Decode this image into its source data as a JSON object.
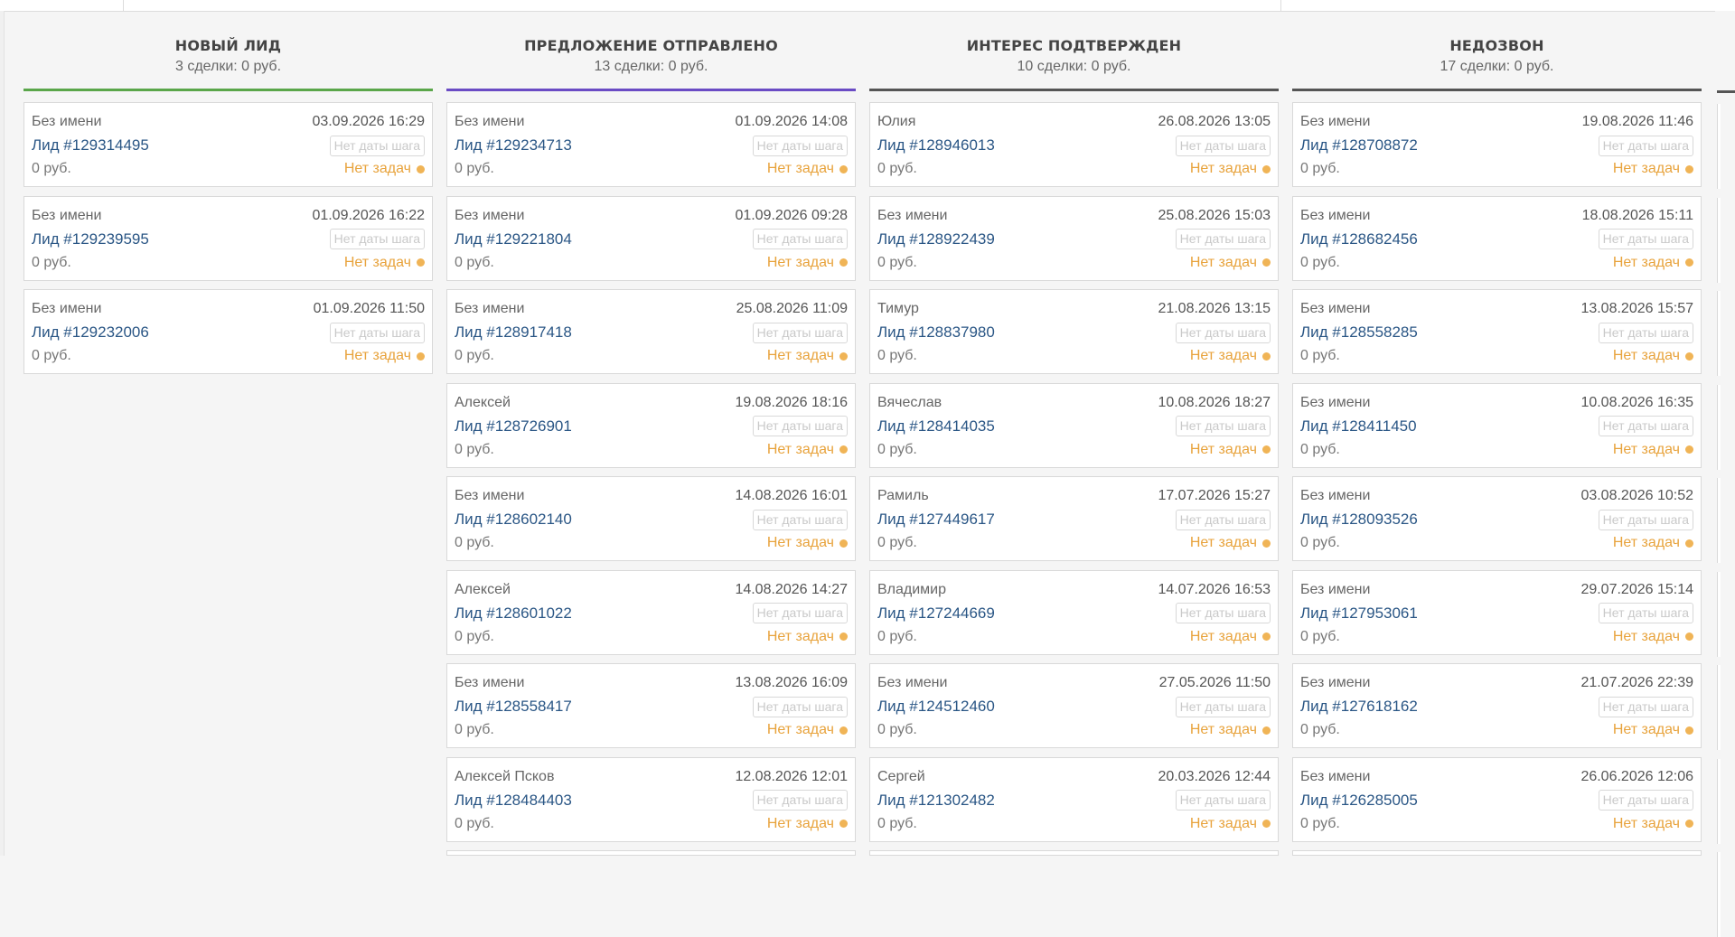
{
  "columns": [
    {
      "title": "НОВЫЙ ЛИД",
      "summary": "3 сделки: 0 руб.",
      "color": "#5aa64a",
      "cards": [
        {
          "name": "Без имени",
          "date": "03.09.2026 16:29",
          "lead": "Лид #129314495",
          "step_date": "Нет даты шага",
          "price": "0 руб.",
          "tasks": "Нет задач"
        },
        {
          "name": "Без имени",
          "date": "01.09.2026 16:22",
          "lead": "Лид #129239595",
          "step_date": "Нет даты шага",
          "price": "0 руб.",
          "tasks": "Нет задач"
        },
        {
          "name": "Без имени",
          "date": "01.09.2026 11:50",
          "lead": "Лид #129232006",
          "step_date": "Нет даты шага",
          "price": "0 руб.",
          "tasks": "Нет задач"
        }
      ]
    },
    {
      "title": "ПРЕДЛОЖЕНИЕ ОТПРАВЛЕНО",
      "summary": "13 сделки: 0 руб.",
      "color": "#6a4bc4",
      "cards": [
        {
          "name": "Без имени",
          "date": "01.09.2026 14:08",
          "lead": "Лид #129234713",
          "step_date": "Нет даты шага",
          "price": "0 руб.",
          "tasks": "Нет задач"
        },
        {
          "name": "Без имени",
          "date": "01.09.2026 09:28",
          "lead": "Лид #129221804",
          "step_date": "Нет даты шага",
          "price": "0 руб.",
          "tasks": "Нет задач"
        },
        {
          "name": "Без имени",
          "date": "25.08.2026 11:09",
          "lead": "Лид #128917418",
          "step_date": "Нет даты шага",
          "price": "0 руб.",
          "tasks": "Нет задач"
        },
        {
          "name": "Алексей",
          "date": "19.08.2026 18:16",
          "lead": "Лид #128726901",
          "step_date": "Нет даты шага",
          "price": "0 руб.",
          "tasks": "Нет задач"
        },
        {
          "name": "Без имени",
          "date": "14.08.2026 16:01",
          "lead": "Лид #128602140",
          "step_date": "Нет даты шага",
          "price": "0 руб.",
          "tasks": "Нет задач"
        },
        {
          "name": "Алексей",
          "date": "14.08.2026 14:27",
          "lead": "Лид #128601022",
          "step_date": "Нет даты шага",
          "price": "0 руб.",
          "tasks": "Нет задач"
        },
        {
          "name": "Без имени",
          "date": "13.08.2026 16:09",
          "lead": "Лид #128558417",
          "step_date": "Нет даты шага",
          "price": "0 руб.",
          "tasks": "Нет задач"
        },
        {
          "name": "Алексей Псков",
          "date": "12.08.2026 12:01",
          "lead": "Лид #128484403",
          "step_date": "Нет даты шага",
          "price": "0 руб.",
          "tasks": "Нет задач"
        }
      ]
    },
    {
      "title": "ИНТЕРЕС ПОДТВЕРЖДЕН",
      "summary": "10 сделки: 0 руб.",
      "color": "#555555",
      "cards": [
        {
          "name": "Юлия",
          "date": "26.08.2026 13:05",
          "lead": "Лид #128946013",
          "step_date": "Нет даты шага",
          "price": "0 руб.",
          "tasks": "Нет задач"
        },
        {
          "name": "Без имени",
          "date": "25.08.2026 15:03",
          "lead": "Лид #128922439",
          "step_date": "Нет даты шага",
          "price": "0 руб.",
          "tasks": "Нет задач"
        },
        {
          "name": "Тимур",
          "date": "21.08.2026 13:15",
          "lead": "Лид #128837980",
          "step_date": "Нет даты шага",
          "price": "0 руб.",
          "tasks": "Нет задач"
        },
        {
          "name": "Вячеслав",
          "date": "10.08.2026 18:27",
          "lead": "Лид #128414035",
          "step_date": "Нет даты шага",
          "price": "0 руб.",
          "tasks": "Нет задач"
        },
        {
          "name": "Рамиль",
          "date": "17.07.2026 15:27",
          "lead": "Лид #127449617",
          "step_date": "Нет даты шага",
          "price": "0 руб.",
          "tasks": "Нет задач"
        },
        {
          "name": "Владимир",
          "date": "14.07.2026 16:53",
          "lead": "Лид #127244669",
          "step_date": "Нет даты шага",
          "price": "0 руб.",
          "tasks": "Нет задач"
        },
        {
          "name": "Без имени",
          "date": "27.05.2026 11:50",
          "lead": "Лид #124512460",
          "step_date": "Нет даты шага",
          "price": "0 руб.",
          "tasks": "Нет задач"
        },
        {
          "name": "Сергей",
          "date": "20.03.2026 12:44",
          "lead": "Лид #121302482",
          "step_date": "Нет даты шага",
          "price": "0 руб.",
          "tasks": "Нет задач"
        }
      ]
    },
    {
      "title": "НЕДОЗВОН",
      "summary": "17 сделки: 0 руб.",
      "color": "#555555",
      "cards": [
        {
          "name": "Без имени",
          "date": "19.08.2026 11:46",
          "lead": "Лид #128708872",
          "step_date": "Нет даты шага",
          "price": "0 руб.",
          "tasks": "Нет задач"
        },
        {
          "name": "Без имени",
          "date": "18.08.2026 15:11",
          "lead": "Лид #128682456",
          "step_date": "Нет даты шага",
          "price": "0 руб.",
          "tasks": "Нет задач"
        },
        {
          "name": "Без имени",
          "date": "13.08.2026 15:57",
          "lead": "Лид #128558285",
          "step_date": "Нет даты шага",
          "price": "0 руб.",
          "tasks": "Нет задач"
        },
        {
          "name": "Без имени",
          "date": "10.08.2026 16:35",
          "lead": "Лид #128411450",
          "step_date": "Нет даты шага",
          "price": "0 руб.",
          "tasks": "Нет задач"
        },
        {
          "name": "Без имени",
          "date": "03.08.2026 10:52",
          "lead": "Лид #128093526",
          "step_date": "Нет даты шага",
          "price": "0 руб.",
          "tasks": "Нет задач"
        },
        {
          "name": "Без имени",
          "date": "29.07.2026 15:14",
          "lead": "Лид #127953061",
          "step_date": "Нет даты шага",
          "price": "0 руб.",
          "tasks": "Нет задач"
        },
        {
          "name": "Без имени",
          "date": "21.07.2026 22:39",
          "lead": "Лид #127618162",
          "step_date": "Нет даты шага",
          "price": "0 руб.",
          "tasks": "Нет задач"
        },
        {
          "name": "Без имени",
          "date": "26.06.2026 12:06",
          "lead": "Лид #126285005",
          "step_date": "Нет даты шага",
          "price": "0 руб.",
          "tasks": "Нет задач"
        }
      ]
    }
  ]
}
